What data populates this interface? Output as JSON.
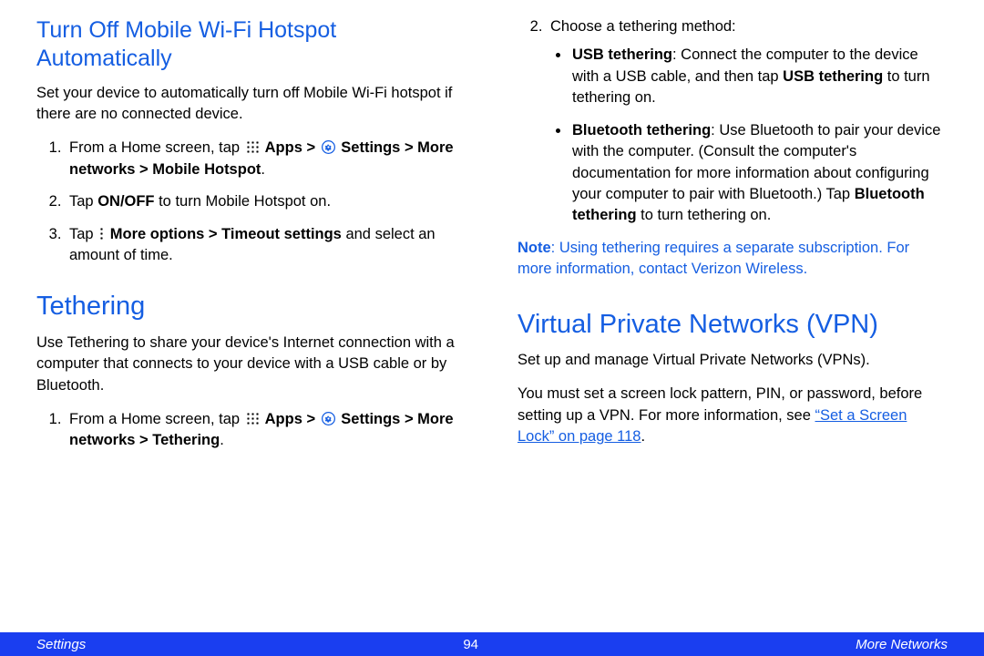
{
  "left": {
    "h2": "Turn Off Mobile Wi-Fi Hotspot Automatically",
    "p1": "Set your device to automatically turn off Mobile Wi-Fi hotspot if there are no connected device.",
    "li1_a": "From a Home screen, tap ",
    "li1_apps": " Apps > ",
    "li1_settings": " Settings > More networks > Mobile Hotspot",
    "li1_end": ".",
    "li2_a": "Tap ",
    "li2_b": "ON/OFF",
    "li2_c": " to turn Mobile Hotspot on.",
    "li3_a": "Tap ",
    "li3_b": " More options > Timeout settings",
    "li3_c": " and select an amount of time.",
    "h1": "Tethering",
    "p2": "Use Tethering to share your device's Internet connection with a computer that connects to your device with a USB cable or by Bluetooth.",
    "li4_a": "From a Home screen, tap ",
    "li4_apps": " Apps > ",
    "li4_settings": " Settings > More networks > Tethering",
    "li4_end": "."
  },
  "right": {
    "li2": "Choose a tethering method:",
    "b1_a": "USB tethering",
    "b1_b": ": Connect the computer to the device with a USB cable, and then tap ",
    "b1_c": "USB tethering",
    "b1_d": " to turn tethering on.",
    "b2_a": "Bluetooth tethering",
    "b2_b": ": Use Bluetooth to pair your device with the computer. (Consult the computer's documentation for more information about configuring your computer to pair with Bluetooth.) Tap ",
    "b2_c": "Bluetooth tethering",
    "b2_d": " to turn tethering on.",
    "note_a": "Note",
    "note_b": ": Using tethering requires a separate subscription. For more information, contact Verizon Wireless.",
    "h1": "Virtual Private Networks (VPN)",
    "p1": "Set up and manage Virtual Private Networks (VPNs).",
    "p2_a": "You must set a screen lock pattern, PIN, or password, before setting up a VPN. For more information, see ",
    "p2_link": "“Set a Screen Lock” on page 118",
    "p2_b": "."
  },
  "footer": {
    "left": "Settings",
    "page": "94",
    "right": "More Networks"
  }
}
